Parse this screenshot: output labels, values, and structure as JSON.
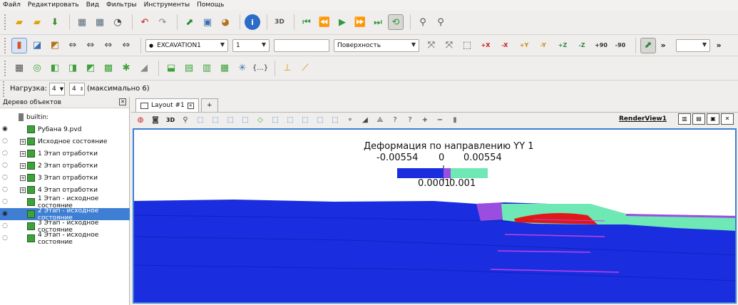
{
  "menu": [
    "Файл",
    "Редактировать",
    "Вид",
    "Фильтры",
    "Инструменты",
    "Помощь"
  ],
  "toolbar2": {
    "dataset_combo": "EXCAVATION1",
    "component_combo": "1",
    "representation_combo": "Поверхность",
    "axis_buttons": [
      "+X",
      "-X",
      "+Y",
      "-Y",
      "+Z",
      "-Z",
      "+90",
      "-90"
    ],
    "more": "»"
  },
  "toolbar4": {
    "load_label": "Нагрузка:",
    "load_value1": "4",
    "load_value2": "4",
    "max_text": "(максимально 6)"
  },
  "pipeline": {
    "title": "Дерево объектов",
    "items": [
      {
        "label": "builtin:"
      },
      {
        "label": "Рубана 9.pvd"
      },
      {
        "label": "Исходное состояние"
      },
      {
        "label": "1 Этап отработки"
      },
      {
        "label": "2 Этап отработки"
      },
      {
        "label": "3 Этап отработки"
      },
      {
        "label": "4 Этап отработки"
      },
      {
        "label": "1 Этап - исходное состояние"
      },
      {
        "label": "2 Этап - исходное состояние"
      },
      {
        "label": "3 Этап - исходное состояние"
      },
      {
        "label": "4 Этап - исходное состояние"
      }
    ]
  },
  "layout": {
    "tab_label": "Layout #1",
    "add_tab": "+",
    "render_view_label": "RenderView1",
    "view_3d": "3D"
  },
  "colorbar": {
    "title": "Деформация по направлению YY 1",
    "min": "-0.00554",
    "zero": "0",
    "max": "0.00554",
    "low_tick": "0.0001",
    "high_tick": "0.001"
  },
  "colors": {
    "mesh_blue": "#1a2ee0",
    "purple": "#9a4ee0",
    "cyan": "#6ee8b4",
    "red": "#e01818",
    "selection_blue": "#3e7fd3"
  }
}
